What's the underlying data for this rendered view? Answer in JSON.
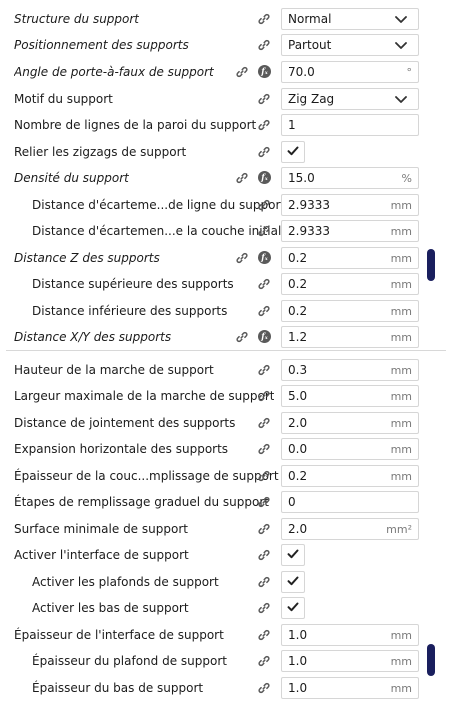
{
  "settings": [
    {
      "key": "structure",
      "label": "Structure du support",
      "italic": true,
      "indent": 0,
      "fx": false,
      "control": "select",
      "value": "Normal",
      "unit": ""
    },
    {
      "key": "placement",
      "label": "Positionnement des supports",
      "italic": true,
      "indent": 0,
      "fx": false,
      "control": "select",
      "value": "Partout",
      "unit": ""
    },
    {
      "key": "angle",
      "label": "Angle de porte-à-faux de support",
      "italic": true,
      "indent": 0,
      "fx": true,
      "control": "text",
      "value": "70.0",
      "unit": "°"
    },
    {
      "key": "pattern",
      "label": "Motif du support",
      "italic": false,
      "indent": 0,
      "fx": false,
      "control": "select",
      "value": "Zig Zag",
      "unit": ""
    },
    {
      "key": "wall_count",
      "label": "Nombre de lignes de la paroi du support",
      "italic": false,
      "indent": 0,
      "fx": false,
      "control": "text",
      "value": "1",
      "unit": ""
    },
    {
      "key": "connect_zigzags",
      "label": "Relier les zigzags de support",
      "italic": false,
      "indent": 0,
      "fx": false,
      "control": "check",
      "value": true,
      "unit": ""
    },
    {
      "key": "density",
      "label": "Densité du support",
      "italic": true,
      "indent": 0,
      "fx": true,
      "control": "text",
      "value": "15.0",
      "unit": "%"
    },
    {
      "key": "line_distance",
      "label": "Distance d'écarteme...de ligne du support",
      "italic": false,
      "indent": 1,
      "fx": false,
      "control": "text",
      "value": "2.9333",
      "unit": "mm"
    },
    {
      "key": "initial_line_distance",
      "label": "Distance d'écartemen...e la couche initiale",
      "italic": false,
      "indent": 1,
      "fx": false,
      "control": "text",
      "value": "2.9333",
      "unit": "mm"
    },
    {
      "key": "z_distance",
      "label": "Distance Z des supports",
      "italic": true,
      "indent": 0,
      "fx": true,
      "control": "text",
      "value": "0.2",
      "unit": "mm"
    },
    {
      "key": "top_distance",
      "label": "Distance supérieure des supports",
      "italic": false,
      "indent": 1,
      "fx": false,
      "control": "text",
      "value": "0.2",
      "unit": "mm"
    },
    {
      "key": "bottom_distance",
      "label": "Distance inférieure des supports",
      "italic": false,
      "indent": 1,
      "fx": false,
      "control": "text",
      "value": "0.2",
      "unit": "mm"
    },
    {
      "key": "xy_distance",
      "label": "Distance X/Y des supports",
      "italic": true,
      "indent": 0,
      "fx": true,
      "control": "text",
      "value": "1.2",
      "unit": "mm"
    },
    {
      "key": "stair_step_height",
      "label": "Hauteur de la marche de support",
      "italic": false,
      "indent": 0,
      "fx": false,
      "control": "text",
      "value": "0.3",
      "unit": "mm"
    },
    {
      "key": "stair_step_width",
      "label": "Largeur maximale de la marche de support",
      "italic": false,
      "indent": 0,
      "fx": false,
      "control": "text",
      "value": "5.0",
      "unit": "mm"
    },
    {
      "key": "join_distance",
      "label": "Distance de jointement des supports",
      "italic": false,
      "indent": 0,
      "fx": false,
      "control": "text",
      "value": "2.0",
      "unit": "mm"
    },
    {
      "key": "horizontal_expansion",
      "label": "Expansion horizontale des supports",
      "italic": false,
      "indent": 0,
      "fx": false,
      "control": "text",
      "value": "0.0",
      "unit": "mm"
    },
    {
      "key": "infill_layer_thickness",
      "label": "Épaisseur de la couc...mplissage de support",
      "italic": false,
      "indent": 0,
      "fx": false,
      "control": "text",
      "value": "0.2",
      "unit": "mm"
    },
    {
      "key": "gradual_infill_steps",
      "label": "Étapes de remplissage graduel du support",
      "italic": false,
      "indent": 0,
      "fx": false,
      "control": "text",
      "value": "0",
      "unit": ""
    },
    {
      "key": "minimum_area",
      "label": "Surface minimale de support",
      "italic": false,
      "indent": 0,
      "fx": false,
      "control": "text",
      "value": "2.0",
      "unit": "mm²"
    },
    {
      "key": "interface_enable",
      "label": "Activer l'interface de support",
      "italic": false,
      "indent": 0,
      "fx": false,
      "control": "check",
      "value": true,
      "unit": ""
    },
    {
      "key": "roof_enable",
      "label": "Activer les plafonds de support",
      "italic": false,
      "indent": 1,
      "fx": false,
      "control": "check",
      "value": true,
      "unit": ""
    },
    {
      "key": "bottom_enable",
      "label": "Activer les bas de support",
      "italic": false,
      "indent": 1,
      "fx": false,
      "control": "check",
      "value": true,
      "unit": ""
    },
    {
      "key": "interface_thickness",
      "label": "Épaisseur de l'interface de support",
      "italic": false,
      "indent": 0,
      "fx": false,
      "control": "text",
      "value": "1.0",
      "unit": "mm"
    },
    {
      "key": "roof_thickness",
      "label": "Épaisseur du plafond de support",
      "italic": false,
      "indent": 1,
      "fx": false,
      "control": "text",
      "value": "1.0",
      "unit": "mm"
    },
    {
      "key": "bottom_thickness",
      "label": "Épaisseur du bas de support",
      "italic": false,
      "indent": 1,
      "fx": false,
      "control": "text",
      "value": "1.0",
      "unit": "mm"
    }
  ],
  "icons": {
    "link": "link-icon",
    "function": "function-icon",
    "chevron": "chevron-down-icon",
    "check": "check-icon"
  },
  "colors": {
    "scroll_thumb": "#1a1f5e",
    "field_border": "#d6d6d6",
    "icon_gray": "#5a5a5a"
  }
}
